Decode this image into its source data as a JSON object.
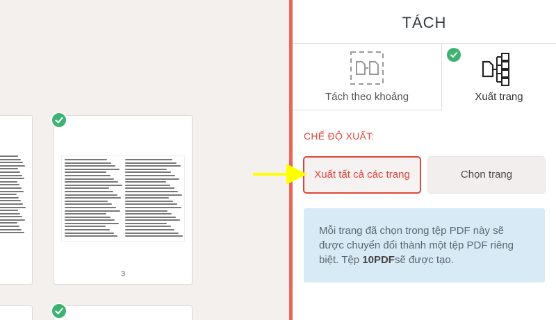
{
  "panel": {
    "title": "TÁCH",
    "modes": [
      {
        "label": "Tách theo khoảng",
        "icon": "range-split-icon",
        "selected": false
      },
      {
        "label": "Xuất trang",
        "icon": "extract-pages-icon",
        "selected": true
      }
    ],
    "section_label": "CHẾ ĐỘ XUẤT:",
    "options": [
      {
        "label": "Xuất tất cả các trang",
        "selected": true
      },
      {
        "label": "Chọn trang",
        "selected": false
      }
    ],
    "info": {
      "part1": "Mỗi trang đã chọn trong tệp PDF này sẽ được chuyển đổi thành một tệp PDF riêng biệt. Tệp ",
      "bold": "10PDF",
      "part2": "sẽ được tạo."
    }
  },
  "preview": {
    "page_number": "3"
  },
  "colors": {
    "accent": "#e0443a",
    "check": "#3cb371",
    "divider": "#e6685c",
    "info_bg": "#d7eaf5",
    "arrow": "#ffff00"
  }
}
